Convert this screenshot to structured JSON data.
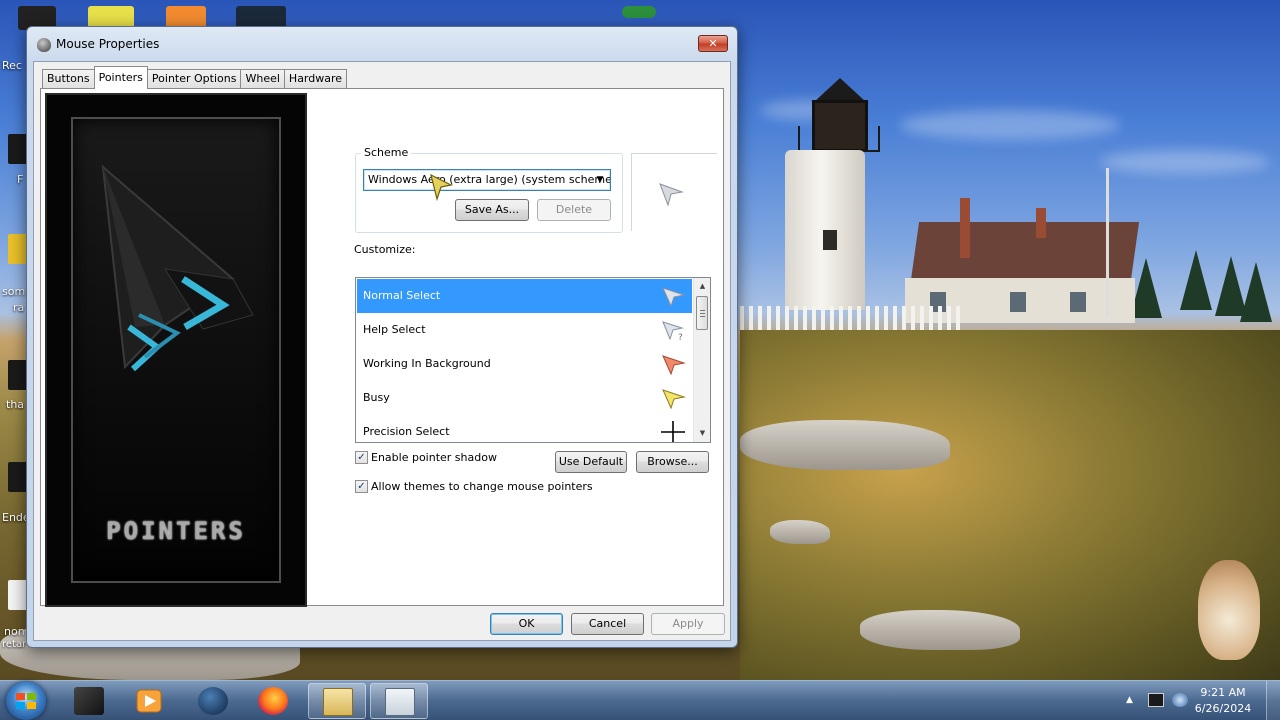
{
  "desktop": {
    "icon_labels": [
      "Rec",
      "F",
      "som",
      "ra",
      "tha",
      "Ende",
      "non",
      "retar"
    ]
  },
  "window": {
    "title": "Mouse Properties",
    "close_glyph": "✕",
    "tabs": [
      {
        "label": "Buttons"
      },
      {
        "label": "Pointers"
      },
      {
        "label": "Pointer Options"
      },
      {
        "label": "Wheel"
      },
      {
        "label": "Hardware"
      }
    ],
    "active_tab": "Pointers"
  },
  "pointers": {
    "art_text": "POINTERS",
    "scheme_label": "Scheme",
    "scheme_value": "Windows Aero (extra large) (system scheme)",
    "save_as_label": "Save As...",
    "delete_label": "Delete",
    "customize_label": "Customize:",
    "items": [
      {
        "label": "Normal Select",
        "icon": "arrow-cursor-icon",
        "selected": true
      },
      {
        "label": "Help Select",
        "icon": "help-cursor-icon",
        "selected": false
      },
      {
        "label": "Working In Background",
        "icon": "working-cursor-icon",
        "selected": false
      },
      {
        "label": "Busy",
        "icon": "busy-cursor-icon",
        "selected": false
      },
      {
        "label": "Precision Select",
        "icon": "crosshair-cursor-icon",
        "selected": false
      }
    ],
    "enable_shadow_label": "Enable pointer shadow",
    "enable_shadow_checked": true,
    "use_default_label": "Use Default",
    "browse_label": "Browse...",
    "allow_themes_label": "Allow themes to change mouse pointers",
    "allow_themes_checked": true
  },
  "dialog_buttons": {
    "ok": "OK",
    "cancel": "Cancel",
    "apply": "Apply"
  },
  "taskbar": {
    "time": "9:21 AM",
    "date": "6/26/2024"
  },
  "colors": {
    "selection": "#3399ff",
    "working_cursor": "#f08a6a",
    "busy_cursor": "#f2e36a"
  }
}
